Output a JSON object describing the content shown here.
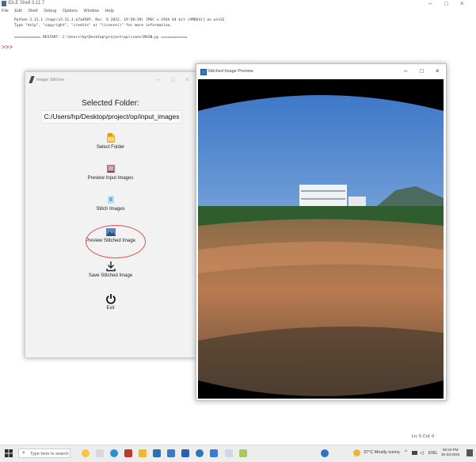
{
  "idle": {
    "title": "IDLE Shell 3.11.7",
    "menu": [
      "File",
      "Edit",
      "Shell",
      "Debug",
      "Options",
      "Window",
      "Help"
    ],
    "prompt": ">>>",
    "shell_lines": [
      "Python 3.11.1 (tags/v3.11.1:a7a450f, Dec  6 2022, 19:58:39) [MSC v.1934 64 bit (AMD64)] on win32",
      "Type \"help\", \"copyright\", \"credits\" or \"license()\" for more information.",
      "",
      "============ RESTART: C:\\Users\\hp\\Desktop\\project\\op\\icons\\MAIN.py ============"
    ],
    "status": "Ln: 5  Col: 0"
  },
  "stitcher": {
    "title": "Image Stitcher",
    "selected_label": "Selected Folder:",
    "selected_path": "C:/Users/hp/Desktop/project/op/input_images",
    "buttons": {
      "select": "Select Folder",
      "preview_input": "Preview Input Images",
      "stitch": "Stitch Images",
      "preview_stitched": "Preview Stitched Image",
      "save": "Save Stitched Image",
      "exit": "Exit"
    }
  },
  "preview": {
    "title": "Stitched Image Preview"
  },
  "taskbar": {
    "search_placeholder": "Type here to search",
    "weather": "37°C  Mostly sunny",
    "lang": "ENG",
    "time": "06:23 PM",
    "date": "30-03-2024"
  },
  "colors": {
    "highlight_ring": "#d9534f",
    "sky": "#6f9fd8",
    "ground": "#b07a54"
  }
}
